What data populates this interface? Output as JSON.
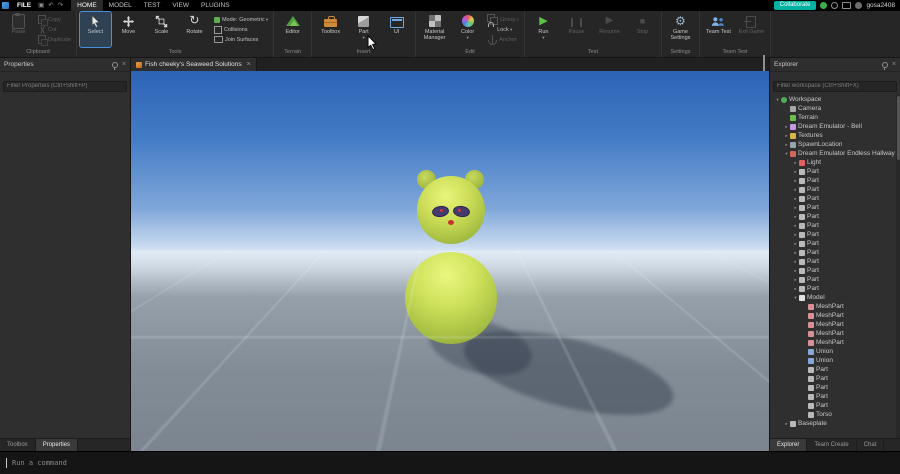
{
  "titlebar": {
    "file_menu": "FILE",
    "menu_tabs": [
      {
        "label": "HOME",
        "active": true
      },
      {
        "label": "MODEL"
      },
      {
        "label": "TEST"
      },
      {
        "label": "VIEW"
      },
      {
        "label": "PLUGINS"
      }
    ],
    "collaborate_label": "Collaborate",
    "username": "gosa2408"
  },
  "ribbon": {
    "clipboard": {
      "group_label": "Clipboard",
      "paste": "Paste",
      "copy": "Copy",
      "cut": "Cut",
      "duplicate": "Duplicate"
    },
    "tools": {
      "group_label": "Tools",
      "select": "Select",
      "move": "Move",
      "scale": "Scale",
      "rotate": "Rotate",
      "mode_label": "Mode:",
      "mode_value": "Geometric",
      "collisions": "Collisions",
      "join_surfaces": "Join Surfaces"
    },
    "terrain": {
      "group_label": "Terrain",
      "editor": "Editor"
    },
    "insert": {
      "group_label": "Insert",
      "toolbox": "Toolbox",
      "part": "Part",
      "ui": "UI"
    },
    "edit": {
      "group_label": "Edit",
      "material_manager": "Material Manager",
      "color": "Color",
      "group": "Group",
      "lock": "Lock",
      "anchor": "Anchor"
    },
    "test": {
      "group_label": "Test",
      "run": "Run",
      "pause": "Pause",
      "resume": "Resume",
      "stop": "Stop"
    },
    "settings": {
      "group_label": "Settings",
      "game_settings": "Game Settings"
    },
    "team_test": {
      "group_label": "Team Test",
      "team_test": "Team Test",
      "exit_game": "Exit Game"
    }
  },
  "properties_panel": {
    "title": "Properties",
    "filter_placeholder": "Filter Properties (Ctrl+Shift+P)",
    "bottom_tabs": [
      {
        "label": "Toolbox"
      },
      {
        "label": "Properties",
        "active": true
      }
    ]
  },
  "viewport": {
    "tab_title": "Fish cheeky's Seaweed Solutions",
    "tab_close": "×"
  },
  "explorer_panel": {
    "title": "Explorer",
    "filter_placeholder": "Filter workspace (Ctrl+Shift+X)",
    "bottom_tabs": [
      {
        "label": "Explorer",
        "active": true
      },
      {
        "label": "Team Create"
      },
      {
        "label": "Chat"
      }
    ],
    "items": [
      {
        "label": "Workspace",
        "depth": 0,
        "arrow": "▾",
        "color": "#4fae57",
        "round": true
      },
      {
        "label": "Camera",
        "depth": 1,
        "arrow": "",
        "color": "#a8a8a8"
      },
      {
        "label": "Terrain",
        "depth": 1,
        "arrow": "",
        "color": "#6cbf4c"
      },
      {
        "label": "Dream Emulator - Bell",
        "depth": 1,
        "arrow": "▸",
        "color": "#c59ae0"
      },
      {
        "label": "Textures",
        "depth": 1,
        "arrow": "▸",
        "color": "#d9b545"
      },
      {
        "label": "SpawnLocation",
        "depth": 1,
        "arrow": "▸",
        "color": "#9aa2ac"
      },
      {
        "label": "Dream Emulator Endless Hallway",
        "depth": 1,
        "arrow": "▾",
        "color": "#d0685a"
      },
      {
        "label": "Light",
        "depth": 2,
        "arrow": "▸",
        "color": "#e05f5f"
      },
      {
        "label": "Part",
        "depth": 2,
        "arrow": "▸",
        "color": "#b9b9b9"
      },
      {
        "label": "Part",
        "depth": 2,
        "arrow": "▸",
        "color": "#b9b9b9"
      },
      {
        "label": "Part",
        "depth": 2,
        "arrow": "▸",
        "color": "#b9b9b9"
      },
      {
        "label": "Part",
        "depth": 2,
        "arrow": "▸",
        "color": "#b9b9b9"
      },
      {
        "label": "Part",
        "depth": 2,
        "arrow": "▸",
        "color": "#b9b9b9"
      },
      {
        "label": "Part",
        "depth": 2,
        "arrow": "▸",
        "color": "#b9b9b9"
      },
      {
        "label": "Part",
        "depth": 2,
        "arrow": "▸",
        "color": "#b9b9b9"
      },
      {
        "label": "Part",
        "depth": 2,
        "arrow": "▸",
        "color": "#b9b9b9"
      },
      {
        "label": "Part",
        "depth": 2,
        "arrow": "▸",
        "color": "#b9b9b9"
      },
      {
        "label": "Part",
        "depth": 2,
        "arrow": "▸",
        "color": "#b9b9b9"
      },
      {
        "label": "Part",
        "depth": 2,
        "arrow": "▸",
        "color": "#b9b9b9"
      },
      {
        "label": "Part",
        "depth": 2,
        "arrow": "▸",
        "color": "#b9b9b9"
      },
      {
        "label": "Part",
        "depth": 2,
        "arrow": "▸",
        "color": "#b9b9b9"
      },
      {
        "label": "Part",
        "depth": 2,
        "arrow": "▸",
        "color": "#b9b9b9"
      },
      {
        "label": "Model",
        "depth": 2,
        "arrow": "▾",
        "color": "#e2e2e2"
      },
      {
        "label": "MeshPart",
        "depth": 3,
        "arrow": "",
        "color": "#d98f98"
      },
      {
        "label": "MeshPart",
        "depth": 3,
        "arrow": "",
        "color": "#d98f98"
      },
      {
        "label": "MeshPart",
        "depth": 3,
        "arrow": "",
        "color": "#d98f98"
      },
      {
        "label": "MeshPart",
        "depth": 3,
        "arrow": "",
        "color": "#d98f98"
      },
      {
        "label": "MeshPart",
        "depth": 3,
        "arrow": "",
        "color": "#d98f98"
      },
      {
        "label": "Union",
        "depth": 3,
        "arrow": "",
        "color": "#84a9d8"
      },
      {
        "label": "Union",
        "depth": 3,
        "arrow": "",
        "color": "#84a9d8"
      },
      {
        "label": "Part",
        "depth": 3,
        "arrow": "",
        "color": "#b9b9b9"
      },
      {
        "label": "Part",
        "depth": 3,
        "arrow": "",
        "color": "#b9b9b9"
      },
      {
        "label": "Part",
        "depth": 3,
        "arrow": "",
        "color": "#b9b9b9"
      },
      {
        "label": "Part",
        "depth": 3,
        "arrow": "",
        "color": "#b9b9b9"
      },
      {
        "label": "Part",
        "depth": 3,
        "arrow": "",
        "color": "#b9b9b9"
      },
      {
        "label": "Torso",
        "depth": 3,
        "arrow": "",
        "color": "#b9b9b9"
      },
      {
        "label": "Baseplate",
        "depth": 1,
        "arrow": "▸",
        "color": "#b9b9b9"
      }
    ]
  },
  "command_bar": {
    "placeholder": "Run a command"
  },
  "colors": {
    "accent_teal": "#00b2a2",
    "run_green": "#5cbf4a",
    "selection_blue": "#4a90d9",
    "character_green": "#cbdd57",
    "sky_top": "#2e63b5",
    "sky_horizon": "#e2edf8",
    "floor_gray": "#838d97"
  }
}
